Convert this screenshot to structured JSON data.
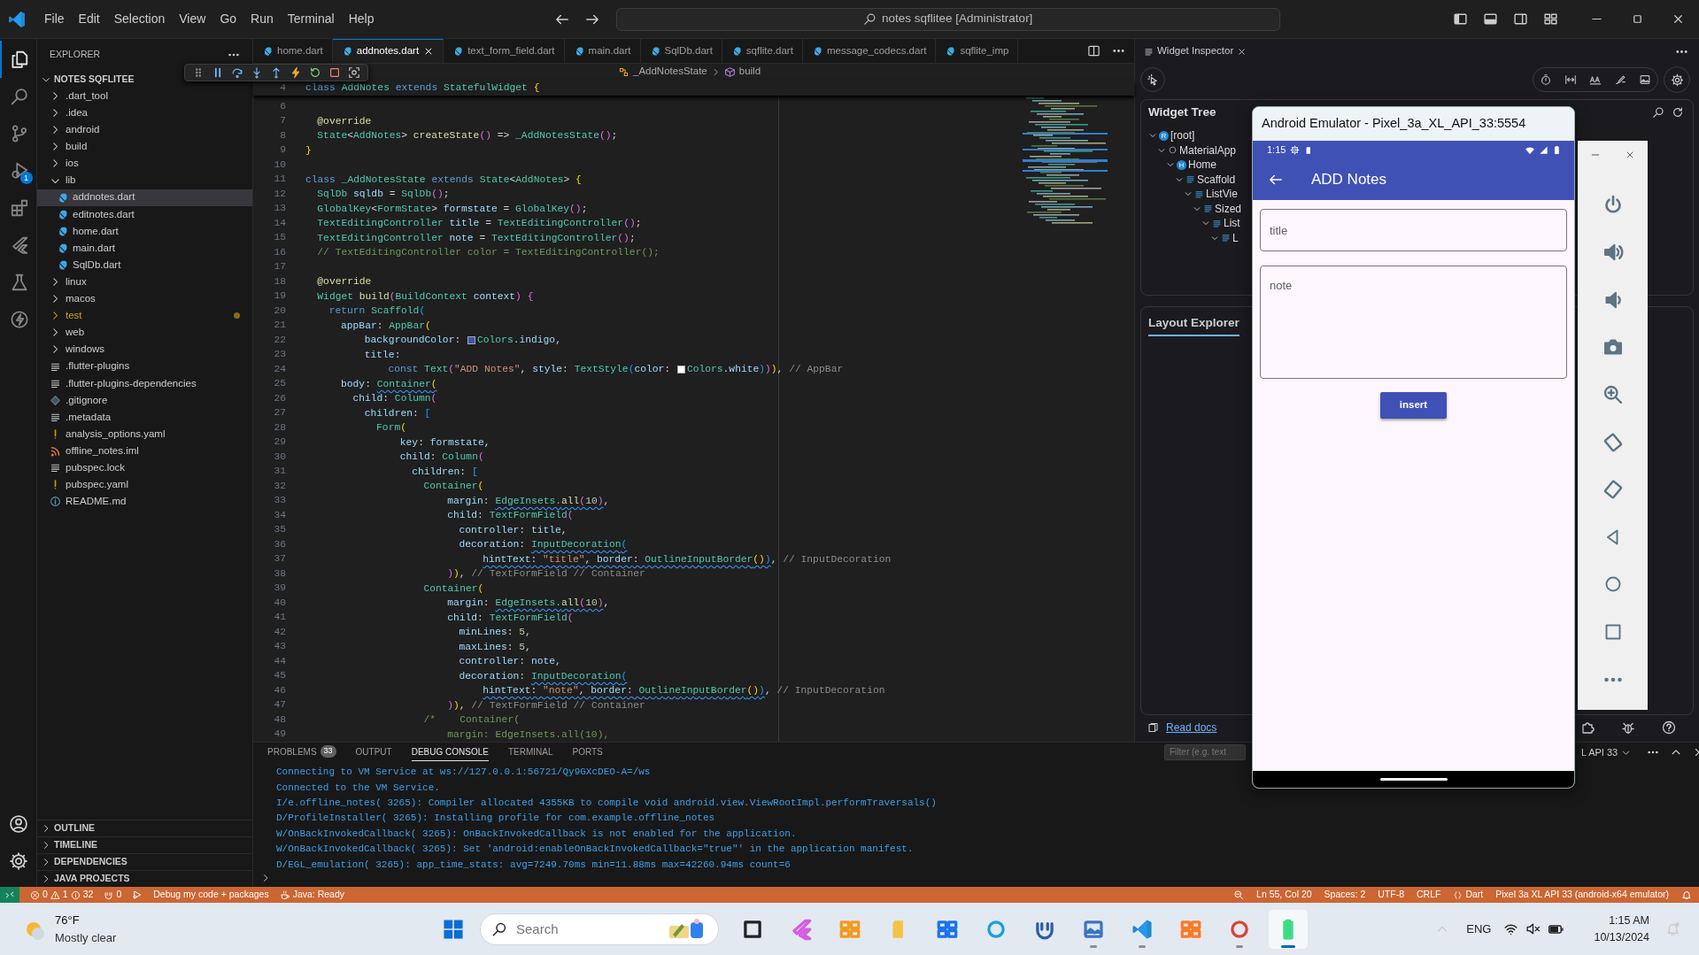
{
  "titlebar": {
    "menu": [
      "File",
      "Edit",
      "Selection",
      "View",
      "Go",
      "Run",
      "Terminal",
      "Help"
    ],
    "command_center": "notes sqflitee [Administrator]"
  },
  "activity_bar": {
    "items": [
      {
        "kind": "explorer",
        "selected": true
      },
      {
        "kind": "search",
        "selected": false
      },
      {
        "kind": "source-control",
        "selected": false
      },
      {
        "kind": "run-debug",
        "selected": false,
        "badge": "1"
      },
      {
        "kind": "extensions",
        "selected": false
      },
      {
        "kind": "flutter",
        "selected": false
      },
      {
        "kind": "testing",
        "selected": false
      },
      {
        "kind": "lightning",
        "selected": false
      }
    ]
  },
  "explorer": {
    "title": "EXPLORER",
    "project": "NOTES SQFLITEE",
    "expanded": true,
    "items": [
      {
        "label": ".dart_tool",
        "kind": "folder",
        "expanded": false,
        "selected": false,
        "warning": false
      },
      {
        "label": ".idea",
        "kind": "folder",
        "expanded": false,
        "selected": false,
        "warning": false
      },
      {
        "label": "android",
        "kind": "folder",
        "expanded": false,
        "selected": false,
        "warning": false
      },
      {
        "label": "build",
        "kind": "folder",
        "expanded": false,
        "selected": false,
        "warning": false
      },
      {
        "label": "ios",
        "kind": "folder",
        "expanded": false,
        "selected": false,
        "warning": false
      },
      {
        "label": "lib",
        "kind": "folder",
        "expanded": true,
        "selected": false,
        "warning": false,
        "children": [
          {
            "label": "addnotes.dart",
            "kind": "dart",
            "selected": true
          },
          {
            "label": "editnotes.dart",
            "kind": "dart",
            "selected": false
          },
          {
            "label": "home.dart",
            "kind": "dart",
            "selected": false
          },
          {
            "label": "main.dart",
            "kind": "dart",
            "selected": false
          },
          {
            "label": "SqlDb.dart",
            "kind": "dart",
            "selected": false
          }
        ]
      },
      {
        "label": "linux",
        "kind": "folder",
        "expanded": false,
        "selected": false,
        "warning": false
      },
      {
        "label": "macos",
        "kind": "folder",
        "expanded": false,
        "selected": false,
        "warning": false
      },
      {
        "label": "test",
        "kind": "folder",
        "expanded": false,
        "selected": false,
        "warning": true
      },
      {
        "label": "web",
        "kind": "folder",
        "expanded": false,
        "selected": false,
        "warning": false
      },
      {
        "label": "windows",
        "kind": "folder",
        "expanded": false,
        "selected": false,
        "warning": false
      },
      {
        "label": ".flutter-plugins",
        "kind": "lines",
        "selected": false,
        "warning": false
      },
      {
        "label": ".flutter-plugins-dependencies",
        "kind": "lines",
        "selected": false,
        "warning": false
      },
      {
        "label": ".gitignore",
        "kind": "git",
        "selected": false,
        "warning": false
      },
      {
        "label": ".metadata",
        "kind": "lines",
        "selected": false,
        "warning": false
      },
      {
        "label": "analysis_options.yaml",
        "kind": "yaml",
        "selected": false,
        "warning": false
      },
      {
        "label": "offline_notes.iml",
        "kind": "iml",
        "selected": false,
        "warning": false
      },
      {
        "label": "pubspec.lock",
        "kind": "lines",
        "selected": false,
        "warning": false
      },
      {
        "label": "pubspec.yaml",
        "kind": "yaml",
        "selected": false,
        "warning": false
      },
      {
        "label": "README.md",
        "kind": "info",
        "selected": false,
        "warning": false
      }
    ],
    "sections": [
      {
        "label": "OUTLINE",
        "expanded": false
      },
      {
        "label": "TIMELINE",
        "expanded": false
      },
      {
        "label": "DEPENDENCIES",
        "expanded": false
      },
      {
        "label": "JAVA PROJECTS",
        "expanded": false
      }
    ]
  },
  "editor": {
    "tabs": [
      {
        "label": "home.dart",
        "selected": false
      },
      {
        "label": "addnotes.dart",
        "selected": true
      },
      {
        "label": "text_form_field.dart",
        "selected": false
      },
      {
        "label": "main.dart",
        "selected": false
      },
      {
        "label": "SqlDb.dart",
        "selected": false
      },
      {
        "label": "sqflite.dart",
        "selected": false
      },
      {
        "label": "message_codecs.dart",
        "selected": false
      },
      {
        "label": "sqflite_imp",
        "selected": false
      }
    ],
    "breadcrumb": [
      {
        "label": "_AddNotesState",
        "kind": "class"
      },
      {
        "label": "build",
        "kind": "method"
      }
    ],
    "sticky": {
      "n": "4",
      "segs": [
        {
          "kind": "keyword",
          "text": "class "
        },
        {
          "kind": "type",
          "text": "AddNotes "
        },
        {
          "kind": "keyword",
          "text": "extends "
        },
        {
          "kind": "type",
          "text": "StatefulWidget "
        },
        {
          "kind": "bracket1",
          "text": "{"
        }
      ]
    },
    "lines": [
      {
        "n": "6"
      },
      {
        "n": "7",
        "segs": [
          {
            "kind": "function",
            "text": "  @override"
          }
        ]
      },
      {
        "n": "8",
        "segs": [
          {
            "kind": "type",
            "text": "  State"
          },
          {
            "kind": "plain",
            "text": "<"
          },
          {
            "kind": "type",
            "text": "AddNotes"
          },
          {
            "kind": "plain",
            "text": "> "
          },
          {
            "kind": "function",
            "text": "createState"
          },
          {
            "kind": "bracket2",
            "text": "()"
          },
          {
            "kind": "plain",
            "text": " => "
          },
          {
            "kind": "type",
            "text": "_AddNotesState"
          },
          {
            "kind": "bracket2",
            "text": "()"
          },
          {
            "kind": "plain",
            "text": ";"
          }
        ]
      },
      {
        "n": "9",
        "segs": [
          {
            "kind": "bracket1",
            "text": "}"
          }
        ]
      },
      {
        "n": "10"
      },
      {
        "n": "11",
        "segs": [
          {
            "kind": "keyword",
            "text": "class "
          },
          {
            "kind": "type",
            "text": "_AddNotesState "
          },
          {
            "kind": "keyword",
            "text": "extends "
          },
          {
            "kind": "type",
            "text": "State"
          },
          {
            "kind": "plain",
            "text": "<"
          },
          {
            "kind": "type",
            "text": "AddNotes"
          },
          {
            "kind": "plain",
            "text": "> "
          },
          {
            "kind": "bracket1",
            "text": "{"
          }
        ]
      },
      {
        "n": "12",
        "segs": [
          {
            "kind": "type",
            "text": "  SqlDb "
          },
          {
            "kind": "variable",
            "text": "sqldb"
          },
          {
            "kind": "plain",
            "text": " = "
          },
          {
            "kind": "type",
            "text": "SqlDb"
          },
          {
            "kind": "bracket2",
            "text": "()"
          },
          {
            "kind": "plain",
            "text": ";"
          }
        ]
      },
      {
        "n": "13",
        "segs": [
          {
            "kind": "type",
            "text": "  GlobalKey"
          },
          {
            "kind": "plain",
            "text": "<"
          },
          {
            "kind": "type",
            "text": "FormState"
          },
          {
            "kind": "plain",
            "text": "> "
          },
          {
            "kind": "variable",
            "text": "formstate"
          },
          {
            "kind": "plain",
            "text": " = "
          },
          {
            "kind": "type",
            "text": "GlobalKey"
          },
          {
            "kind": "bracket2",
            "text": "()"
          },
          {
            "kind": "plain",
            "text": ";"
          }
        ]
      },
      {
        "n": "14",
        "segs": [
          {
            "kind": "type",
            "text": "  TextEditingController "
          },
          {
            "kind": "variable",
            "text": "title"
          },
          {
            "kind": "plain",
            "text": " = "
          },
          {
            "kind": "type",
            "text": "TextEditingController"
          },
          {
            "kind": "bracket2",
            "text": "()"
          },
          {
            "kind": "plain",
            "text": ";"
          }
        ]
      },
      {
        "n": "15",
        "segs": [
          {
            "kind": "type",
            "text": "  TextEditingController "
          },
          {
            "kind": "variable",
            "text": "note"
          },
          {
            "kind": "plain",
            "text": " = "
          },
          {
            "kind": "type",
            "text": "TextEditingController"
          },
          {
            "kind": "bracket2",
            "text": "()"
          },
          {
            "kind": "plain",
            "text": ";"
          }
        ]
      },
      {
        "n": "16",
        "segs": [
          {
            "kind": "comment",
            "text": "  // TextEditingController color = TextEditingController();"
          }
        ]
      },
      {
        "n": "17"
      },
      {
        "n": "18",
        "segs": [
          {
            "kind": "function",
            "text": "  @override"
          }
        ]
      },
      {
        "n": "19",
        "segs": [
          {
            "kind": "type",
            "text": "  Widget "
          },
          {
            "kind": "function",
            "text": "build"
          },
          {
            "kind": "bracket2",
            "text": "("
          },
          {
            "kind": "type",
            "text": "BuildContext "
          },
          {
            "kind": "variable",
            "text": "context"
          },
          {
            "kind": "bracket2",
            "text": ") {"
          }
        ]
      },
      {
        "n": "20",
        "segs": [
          {
            "kind": "keyword",
            "text": "    return "
          },
          {
            "kind": "type",
            "text": "Scaffold"
          },
          {
            "kind": "bracket3",
            "text": "("
          }
        ]
      },
      {
        "n": "21",
        "segs": [
          {
            "kind": "variable",
            "text": "      appBar"
          },
          {
            "kind": "plain",
            "text": ": "
          },
          {
            "kind": "type",
            "text": "AppBar"
          },
          {
            "kind": "bracket1",
            "text": "("
          }
        ]
      },
      {
        "n": "22",
        "segs": [
          {
            "kind": "variable",
            "text": "          backgroundColor"
          },
          {
            "kind": "plain",
            "text": ": "
          },
          {
            "kind": "swatch",
            "color": "#3f51b5"
          },
          {
            "kind": "type",
            "text": "Colors"
          },
          {
            "kind": "plain",
            "text": "."
          },
          {
            "kind": "variable",
            "text": "indigo"
          },
          {
            "kind": "plain",
            "text": ","
          }
        ]
      },
      {
        "n": "23",
        "segs": [
          {
            "kind": "variable",
            "text": "          title"
          },
          {
            "kind": "plain",
            "text": ":"
          }
        ]
      },
      {
        "n": "24",
        "segs": [
          {
            "kind": "keyword",
            "text": "              const "
          },
          {
            "kind": "type",
            "text": "Text"
          },
          {
            "kind": "bracket2",
            "text": "("
          },
          {
            "kind": "string",
            "text": "\"ADD Notes\""
          },
          {
            "kind": "plain",
            "text": ", "
          },
          {
            "kind": "variable",
            "text": "style"
          },
          {
            "kind": "plain",
            "text": ": "
          },
          {
            "kind": "type",
            "text": "TextStyle"
          },
          {
            "kind": "bracket3",
            "text": "("
          },
          {
            "kind": "variable",
            "text": "color"
          },
          {
            "kind": "plain",
            "text": ": "
          },
          {
            "kind": "swatch",
            "color": "#ffffff"
          },
          {
            "kind": "type",
            "text": "Colors"
          },
          {
            "kind": "plain",
            "text": "."
          },
          {
            "kind": "variable",
            "text": "white"
          },
          {
            "kind": "bracket3",
            "text": ")"
          },
          {
            "kind": "bracket2",
            "text": ")"
          },
          {
            "kind": "bracket1",
            "text": ")"
          },
          {
            "kind": "plain",
            "text": ", "
          },
          {
            "kind": "hint",
            "text": "// AppBar"
          }
        ]
      },
      {
        "n": "25",
        "segs": [
          {
            "kind": "variable",
            "text": "      body"
          },
          {
            "kind": "plain",
            "text": ": "
          },
          {
            "kind": "type",
            "text": "Container",
            "warn": true
          },
          {
            "kind": "bracket1",
            "text": "(",
            "warn": true
          }
        ]
      },
      {
        "n": "26",
        "segs": [
          {
            "kind": "variable",
            "text": "        child"
          },
          {
            "kind": "plain",
            "text": ": "
          },
          {
            "kind": "type",
            "text": "Column"
          },
          {
            "kind": "bracket2",
            "text": "("
          }
        ]
      },
      {
        "n": "27",
        "segs": [
          {
            "kind": "variable",
            "text": "          children"
          },
          {
            "kind": "plain",
            "text": ": "
          },
          {
            "kind": "bracket3",
            "text": "["
          }
        ]
      },
      {
        "n": "28",
        "segs": [
          {
            "kind": "type",
            "text": "            Form"
          },
          {
            "kind": "bracket1",
            "text": "("
          }
        ]
      },
      {
        "n": "29",
        "segs": [
          {
            "kind": "variable",
            "text": "                key"
          },
          {
            "kind": "plain",
            "text": ": "
          },
          {
            "kind": "variable",
            "text": "formstate"
          },
          {
            "kind": "plain",
            "text": ","
          }
        ]
      },
      {
        "n": "30",
        "segs": [
          {
            "kind": "variable",
            "text": "                child"
          },
          {
            "kind": "plain",
            "text": ": "
          },
          {
            "kind": "type",
            "text": "Column"
          },
          {
            "kind": "bracket2",
            "text": "("
          }
        ]
      },
      {
        "n": "31",
        "segs": [
          {
            "kind": "variable",
            "text": "                  children"
          },
          {
            "kind": "plain",
            "text": ": "
          },
          {
            "kind": "bracket3",
            "text": "["
          }
        ]
      },
      {
        "n": "32",
        "segs": [
          {
            "kind": "type",
            "text": "                    Container"
          },
          {
            "kind": "bracket1",
            "text": "("
          }
        ]
      },
      {
        "n": "33",
        "segs": [
          {
            "kind": "variable",
            "text": "                        margin"
          },
          {
            "kind": "plain",
            "text": ": "
          },
          {
            "kind": "type",
            "text": "EdgeInsets.",
            "warn": true
          },
          {
            "kind": "function",
            "text": "all",
            "warn": true
          },
          {
            "kind": "bracket2",
            "text": "(",
            "warn": true
          },
          {
            "kind": "number",
            "text": "10",
            "warn": true
          },
          {
            "kind": "bracket2",
            "text": ")",
            "warn": true
          },
          {
            "kind": "plain",
            "text": ","
          }
        ]
      },
      {
        "n": "34",
        "segs": [
          {
            "kind": "variable",
            "text": "                        child"
          },
          {
            "kind": "plain",
            "text": ": "
          },
          {
            "kind": "type",
            "text": "TextFormField"
          },
          {
            "kind": "bracket2",
            "text": "("
          }
        ]
      },
      {
        "n": "35",
        "segs": [
          {
            "kind": "variable",
            "text": "                          controller"
          },
          {
            "kind": "plain",
            "text": ": "
          },
          {
            "kind": "variable",
            "text": "title"
          },
          {
            "kind": "plain",
            "text": ","
          }
        ]
      },
      {
        "n": "36",
        "segs": [
          {
            "kind": "variable",
            "text": "                          decoration"
          },
          {
            "kind": "plain",
            "text": ": "
          },
          {
            "kind": "type",
            "text": "InputDecoration",
            "warn": true
          },
          {
            "kind": "bracket3",
            "text": "(",
            "warn": true
          }
        ]
      },
      {
        "n": "37",
        "segs": [
          {
            "kind": "variable",
            "text": "                              hintText",
            "warn": true
          },
          {
            "kind": "plain",
            "text": ": ",
            "warn": true
          },
          {
            "kind": "string",
            "text": "\"title\"",
            "warn": true
          },
          {
            "kind": "plain",
            "text": ", ",
            "warn": true
          },
          {
            "kind": "variable",
            "text": "border",
            "warn": true
          },
          {
            "kind": "plain",
            "text": ": ",
            "warn": true
          },
          {
            "kind": "type",
            "text": "OutlineInputBorder",
            "warn": true
          },
          {
            "kind": "bracket1",
            "text": "()",
            "warn": true
          },
          {
            "kind": "bracket3",
            "text": ")",
            "warn": true
          },
          {
            "kind": "plain",
            "text": ", "
          },
          {
            "kind": "hint",
            "text": "// InputDecoration"
          }
        ]
      },
      {
        "n": "38",
        "segs": [
          {
            "kind": "bracket2",
            "text": "                        )"
          },
          {
            "kind": "bracket1",
            "text": ")"
          },
          {
            "kind": "plain",
            "text": ", "
          },
          {
            "kind": "hint",
            "text": "// TextFormField // Container"
          }
        ]
      },
      {
        "n": "39",
        "segs": [
          {
            "kind": "type",
            "text": "                    Container"
          },
          {
            "kind": "bracket1",
            "text": "("
          }
        ]
      },
      {
        "n": "40",
        "segs": [
          {
            "kind": "variable",
            "text": "                        margin"
          },
          {
            "kind": "plain",
            "text": ": "
          },
          {
            "kind": "type",
            "text": "EdgeInsets.",
            "warn": true
          },
          {
            "kind": "function",
            "text": "all",
            "warn": true
          },
          {
            "kind": "bracket2",
            "text": "(",
            "warn": true
          },
          {
            "kind": "number",
            "text": "10",
            "warn": true
          },
          {
            "kind": "bracket2",
            "text": ")",
            "warn": true
          },
          {
            "kind": "plain",
            "text": ","
          }
        ]
      },
      {
        "n": "41",
        "segs": [
          {
            "kind": "variable",
            "text": "                        child"
          },
          {
            "kind": "plain",
            "text": ": "
          },
          {
            "kind": "type",
            "text": "TextFormField"
          },
          {
            "kind": "bracket2",
            "text": "("
          }
        ]
      },
      {
        "n": "42",
        "segs": [
          {
            "kind": "variable",
            "text": "                          minLines"
          },
          {
            "kind": "plain",
            "text": ": "
          },
          {
            "kind": "number",
            "text": "5"
          },
          {
            "kind": "plain",
            "text": ","
          }
        ]
      },
      {
        "n": "43",
        "segs": [
          {
            "kind": "variable",
            "text": "                          maxLines"
          },
          {
            "kind": "plain",
            "text": ": "
          },
          {
            "kind": "number",
            "text": "5"
          },
          {
            "kind": "plain",
            "text": ","
          }
        ]
      },
      {
        "n": "44",
        "segs": [
          {
            "kind": "variable",
            "text": "                          controller"
          },
          {
            "kind": "plain",
            "text": ": "
          },
          {
            "kind": "variable",
            "text": "note"
          },
          {
            "kind": "plain",
            "text": ","
          }
        ]
      },
      {
        "n": "45",
        "segs": [
          {
            "kind": "variable",
            "text": "                          decoration"
          },
          {
            "kind": "plain",
            "text": ": "
          },
          {
            "kind": "type",
            "text": "InputDecoration",
            "warn": true
          },
          {
            "kind": "bracket3",
            "text": "(",
            "warn": true
          }
        ]
      },
      {
        "n": "46",
        "segs": [
          {
            "kind": "variable",
            "text": "                              hintText",
            "warn": true
          },
          {
            "kind": "plain",
            "text": ": ",
            "warn": true
          },
          {
            "kind": "string",
            "text": "\"note\"",
            "warn": true
          },
          {
            "kind": "plain",
            "text": ", ",
            "warn": true
          },
          {
            "kind": "variable",
            "text": "border",
            "warn": true
          },
          {
            "kind": "plain",
            "text": ": ",
            "warn": true
          },
          {
            "kind": "type",
            "text": "OutlineInputBorder",
            "warn": true
          },
          {
            "kind": "bracket1",
            "text": "()",
            "warn": true
          },
          {
            "kind": "bracket3",
            "text": ")",
            "warn": true
          },
          {
            "kind": "plain",
            "text": ", "
          },
          {
            "kind": "hint",
            "text": "// InputDecoration"
          }
        ]
      },
      {
        "n": "47",
        "segs": [
          {
            "kind": "bracket2",
            "text": "                        )"
          },
          {
            "kind": "bracket1",
            "text": ")"
          },
          {
            "kind": "plain",
            "text": ", "
          },
          {
            "kind": "hint",
            "text": "// TextFormField // Container"
          }
        ]
      },
      {
        "n": "48",
        "segs": [
          {
            "kind": "comment",
            "text": "                    /*    Container("
          }
        ]
      },
      {
        "n": "49",
        "segs": [
          {
            "kind": "comment",
            "text": "                        margin: EdgeInsets.all(10),"
          }
        ]
      }
    ]
  },
  "widget_inspector": {
    "tab": "Widget Inspector",
    "tree_title": "Widget Tree",
    "nodes": [
      {
        "label": "[root]",
        "kind": "root",
        "badge": "R",
        "expanded": true,
        "children": [
          {
            "label": "MaterialApp",
            "kind": "material",
            "expanded": true,
            "children": [
              {
                "label": "Home",
                "kind": "root",
                "badge": "H",
                "expanded": true,
                "children": [
                  {
                    "label": "Scaffold",
                    "kind": "scaffold",
                    "expanded": true,
                    "children": [
                      {
                        "label": "ListVie",
                        "kind": "list",
                        "expanded": true,
                        "children": [
                          {
                            "label": "Sized",
                            "kind": "sized",
                            "expanded": true,
                            "children": [
                              {
                                "label": "List",
                                "kind": "list",
                                "expanded": true,
                                "children": [
                                  {
                                    "label": "L",
                                    "kind": "list",
                                    "expanded": true
                                  }
                                ]
                              }
                            ]
                          }
                        ]
                      }
                    ]
                  }
                ]
              }
            ]
          }
        ]
      }
    ],
    "layout_tab": "Layout Explorer",
    "read_docs": "Read docs"
  },
  "panel": {
    "tabs": [
      {
        "label": "PROBLEMS",
        "badge": "33",
        "selected": false
      },
      {
        "label": "OUTPUT",
        "selected": false
      },
      {
        "label": "DEBUG CONSOLE",
        "selected": true
      },
      {
        "label": "TERMINAL",
        "selected": false
      },
      {
        "label": "PORTS",
        "selected": false
      }
    ],
    "filter": {
      "placeholder": "Filter (e.g. text"
    },
    "device": "L API 33",
    "console": [
      "Connecting to VM Service at ws://127.0.0.1:56721/Qy9GXcDEO-A=/ws",
      "Connected to the VM Service.",
      "I/e.offline_notes( 3265): Compiler allocated 4355KB to compile void android.view.ViewRootImpl.performTraversals()",
      "D/ProfileInstaller( 3265): Installing profile for com.example.offline_notes",
      "W/OnBackInvokedCallback( 3265): OnBackInvokedCallback is not enabled for the application.",
      "W/OnBackInvokedCallback( 3265): Set 'android:enableOnBackInvokedCallback=\"true\"' in the application manifest.",
      "D/EGL_emulation( 3265): app_time_stats: avg=7249.70ms min=11.88ms max=42260.94ms count=6"
    ]
  },
  "status_bar": {
    "errors": "0",
    "warnings": "1",
    "infos": "32",
    "ports": "0",
    "debug": "Debug my code + packages",
    "java": "Java: Ready",
    "position": "Ln 55, Col 20",
    "spaces": "Spaces: 2",
    "encoding": "UTF-8",
    "eol": "CRLF",
    "language": "Dart",
    "device": "Pixel 3a XL API 33 (android-x64 emulator)"
  },
  "emulator": {
    "title": "Android Emulator - Pixel_3a_XL_API_33:5554",
    "time": "1:15",
    "app_title": "ADD Notes",
    "fields": [
      {
        "placeholder": "title",
        "kind": "single"
      },
      {
        "placeholder": "note",
        "kind": "multi"
      }
    ],
    "button": "insert"
  },
  "taskbar": {
    "temperature": "76°F",
    "weather": "Mostly clear",
    "search": {
      "placeholder": "Search"
    },
    "apps": [
      {
        "kind": "taskview",
        "running": false,
        "selected": false
      },
      {
        "kind": "copilot",
        "running": false,
        "selected": false
      },
      {
        "kind": "boxes",
        "running": false,
        "selected": false
      },
      {
        "kind": "folder",
        "running": false,
        "selected": false
      },
      {
        "kind": "store",
        "running": false,
        "selected": false
      },
      {
        "kind": "edge",
        "running": false,
        "selected": false
      },
      {
        "kind": "usb",
        "running": false,
        "selected": false
      },
      {
        "kind": "monitor",
        "running": true,
        "selected": false
      },
      {
        "kind": "vscode",
        "running": true,
        "selected": false
      },
      {
        "kind": "xampp",
        "running": false,
        "selected": false
      },
      {
        "kind": "chrome",
        "running": true,
        "selected": false
      },
      {
        "kind": "emulator",
        "running": true,
        "selected": true
      }
    ],
    "language": "ENG",
    "time": "1:15 AM",
    "date": "10/13/2024"
  }
}
